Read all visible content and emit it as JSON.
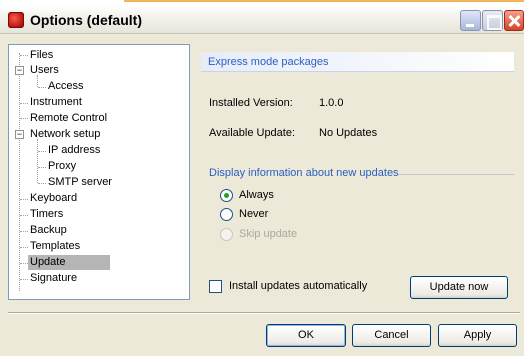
{
  "window": {
    "title": "Options (default)"
  },
  "tree": {
    "items": [
      {
        "label": "Files"
      },
      {
        "label": "Users"
      },
      {
        "label": "Access"
      },
      {
        "label": "Instrument"
      },
      {
        "label": "Remote Control"
      },
      {
        "label": "Network setup"
      },
      {
        "label": "IP address"
      },
      {
        "label": "Proxy"
      },
      {
        "label": "SMTP server"
      },
      {
        "label": "Keyboard"
      },
      {
        "label": "Timers"
      },
      {
        "label": "Backup"
      },
      {
        "label": "Templates"
      },
      {
        "label": "Update"
      },
      {
        "label": "Signature"
      }
    ],
    "selected": "Update",
    "expanders": {
      "users": "−",
      "network": "−"
    }
  },
  "panel": {
    "header": "Express mode packages",
    "installed_label": "Installed Version:",
    "installed_value": "1.0.0",
    "available_label": "Available Update:",
    "available_value": "No Updates",
    "display_group_title": "Display information about new updates",
    "radios": [
      {
        "label": "Always",
        "checked": true,
        "disabled": false
      },
      {
        "label": "Never",
        "checked": false,
        "disabled": false
      },
      {
        "label": "Skip update",
        "checked": false,
        "disabled": true
      }
    ],
    "auto_install_label": "Install updates automatically",
    "auto_install_checked": false,
    "update_now_label": "Update now"
  },
  "footer": {
    "ok_label": "OK",
    "cancel_label": "Cancel",
    "apply_label": "Apply"
  },
  "colors": {
    "accent_blue": "#2a5fc2",
    "window_bg": "#ece9d8",
    "selection_bg": "#b5b5b5"
  }
}
